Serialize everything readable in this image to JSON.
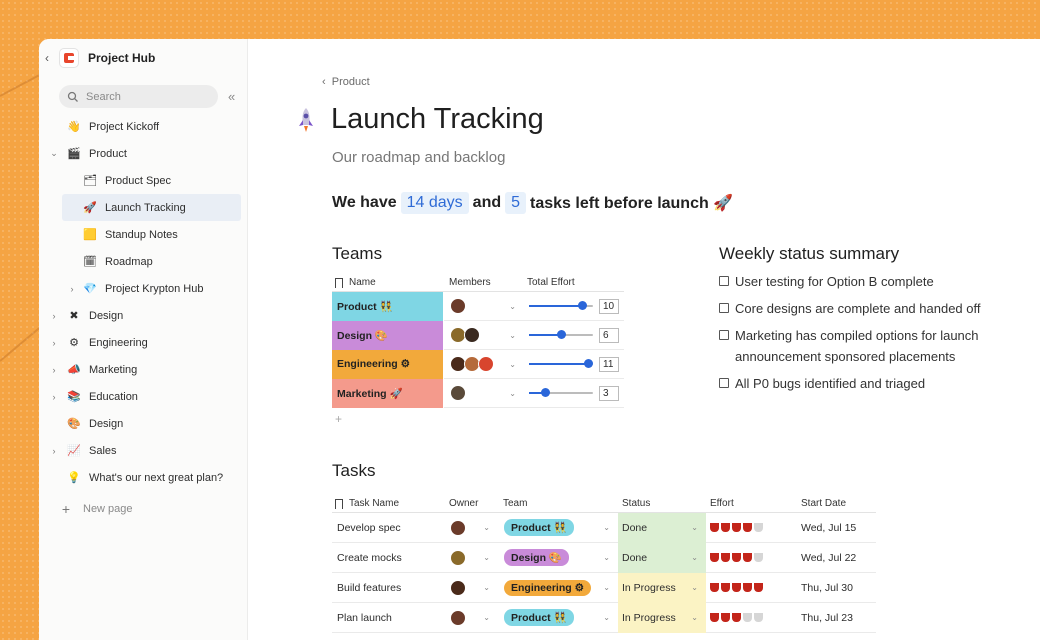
{
  "colors": {
    "background": "#f5a443",
    "accent": "#2a66d9",
    "team_product": "#7fd6e4",
    "team_design": "#c98bd9",
    "team_engineering": "#f2a93b",
    "team_marketing": "#f49a8c",
    "status_done": "#dcefd3",
    "status_progress": "#fbf3c4"
  },
  "sidebar": {
    "title": "Project Hub",
    "back_icon": "chevron-left",
    "search_placeholder": "Search",
    "collapse_icon": "«",
    "items": [
      {
        "label": "Project Kickoff",
        "icon": "wave-hand-icon",
        "glyph": "👋",
        "level": 0,
        "chevron": ""
      },
      {
        "label": "Product",
        "icon": "clapper-icon",
        "glyph": "🎬",
        "level": 0,
        "chevron": "⌄"
      },
      {
        "label": "Product Spec",
        "icon": "stack-icon",
        "glyph": "🗂",
        "level": 1,
        "chevron": ""
      },
      {
        "label": "Launch Tracking",
        "icon": "rocket-icon",
        "glyph": "🚀",
        "level": 1,
        "chevron": "",
        "active": true
      },
      {
        "label": "Standup Notes",
        "icon": "note-icon",
        "glyph": "🟨",
        "level": 1,
        "chevron": ""
      },
      {
        "label": "Roadmap",
        "icon": "grid-icon",
        "glyph": "🗓",
        "level": 1,
        "chevron": ""
      },
      {
        "label": "Project Krypton Hub",
        "icon": "gem-icon",
        "glyph": "💎",
        "level": 2,
        "chevron": "›"
      },
      {
        "label": "Design",
        "icon": "tools-icon",
        "glyph": "✖",
        "level": 0,
        "chevron": "›"
      },
      {
        "label": "Engineering",
        "icon": "gear-icon",
        "glyph": "⚙",
        "level": 0,
        "chevron": "›"
      },
      {
        "label": "Marketing",
        "icon": "megaphone-icon",
        "glyph": "📣",
        "level": 0,
        "chevron": "›"
      },
      {
        "label": "Education",
        "icon": "books-icon",
        "glyph": "📚",
        "level": 0,
        "chevron": "›"
      },
      {
        "label": "Design",
        "icon": "palette-icon",
        "glyph": "🎨",
        "level": 0,
        "chevron": ""
      },
      {
        "label": "Sales",
        "icon": "chart-icon",
        "glyph": "📈",
        "level": 0,
        "chevron": "›"
      },
      {
        "label": "What's our next great plan?",
        "icon": "bulb-icon",
        "glyph": "💡",
        "level": 0,
        "chevron": ""
      }
    ],
    "new_page": "New page"
  },
  "main": {
    "breadcrumb": "Product",
    "breadcrumb_icon": "chevron-left",
    "title": "Launch Tracking",
    "subtitle": "Our roadmap and backlog",
    "headline": {
      "pre": "We have",
      "days": "14 days",
      "mid": "and",
      "tasks": "5",
      "post": "tasks left before launch 🚀"
    }
  },
  "teams": {
    "heading": "Teams",
    "columns": [
      "Name",
      "Members",
      "Total Effort"
    ],
    "rows": [
      {
        "name": "Product 👯",
        "color": "#7fd6e4",
        "members": [
          "#6b3b2a"
        ],
        "effort": 10,
        "max": 11
      },
      {
        "name": "Design 🎨",
        "color": "#c98bd9",
        "members": [
          "#8a6a2a",
          "#3a2a20"
        ],
        "effort": 6,
        "max": 11
      },
      {
        "name": "Engineering ⚙",
        "color": "#f2a93b",
        "members": [
          "#4a2a1a",
          "#b56a3a",
          "#d8452e"
        ],
        "effort": 11,
        "max": 11
      },
      {
        "name": "Marketing 🚀",
        "color": "#f49a8c",
        "members": [
          "#5a4a3a"
        ],
        "effort": 3,
        "max": 11
      }
    ],
    "add_label": "+"
  },
  "summary": {
    "heading": "Weekly status summary",
    "items": [
      "User testing for Option B complete",
      "Core designs are complete and handed off",
      "Marketing has compiled options for launch announcement sponsored placements",
      "All P0 bugs identified and triaged"
    ]
  },
  "tasks": {
    "heading": "Tasks",
    "columns": [
      "Task Name",
      "Owner",
      "Team",
      "Status",
      "Effort",
      "Start Date"
    ],
    "rows": [
      {
        "name": "Develop spec",
        "owner": "#6b3b2a",
        "team": "Product 👯",
        "team_color": "#7fd6e4",
        "status": "Done",
        "status_color": "#dcefd3",
        "effort": 4,
        "date": "Wed, Jul 15"
      },
      {
        "name": "Create mocks",
        "owner": "#8a6a2a",
        "team": "Design 🎨",
        "team_color": "#c98bd9",
        "status": "Done",
        "status_color": "#dcefd3",
        "effort": 4,
        "date": "Wed, Jul 22"
      },
      {
        "name": "Build features",
        "owner": "#4a2a1a",
        "team": "Engineering ⚙",
        "team_color": "#f2a93b",
        "status": "In Progress",
        "status_color": "#fbf3c4",
        "effort": 5,
        "date": "Thu, Jul 30"
      },
      {
        "name": "Plan launch",
        "owner": "#6b3b2a",
        "team": "Product 👯",
        "team_color": "#7fd6e4",
        "status": "In Progress",
        "status_color": "#fbf3c4",
        "effort": 3,
        "date": "Thu, Jul 23"
      }
    ]
  }
}
